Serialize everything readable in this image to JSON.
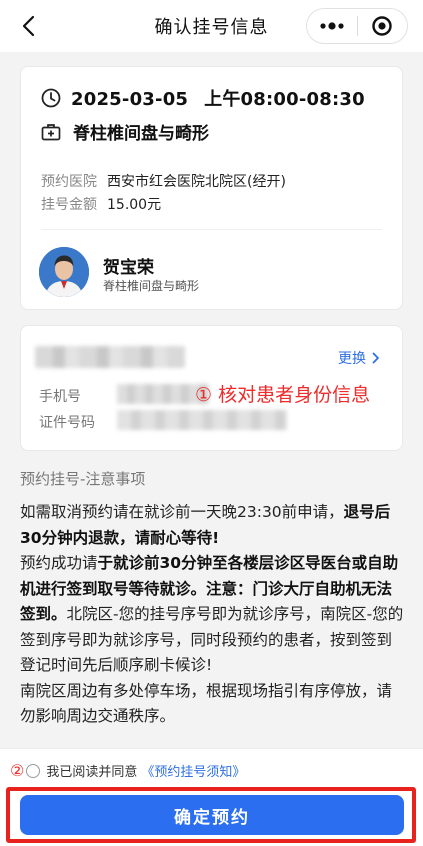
{
  "header": {
    "title": "确认挂号信息"
  },
  "appointment": {
    "date": "2025-03-05",
    "time_slot": "上午08:00-08:30",
    "department": "脊柱椎间盘与畸形",
    "hospital_label": "预约医院",
    "hospital_value": "西安市红会医院北院区(经开)",
    "fee_label": "挂号金额",
    "fee_value": "15.00元"
  },
  "doctor": {
    "name": "贺宝荣",
    "department": "脊柱椎间盘与畸形"
  },
  "patient": {
    "change_label": "更换",
    "phone_label": "手机号",
    "id_label": "证件号码"
  },
  "annotations": {
    "one": "① 核对患者身份信息",
    "two": "②"
  },
  "notice": {
    "title": "预约挂号-注意事项",
    "p1_a": "如需取消预约请在就诊前一天晚23:30前申请，",
    "p1_b": "退号后30分钟内退款，请耐心等待!",
    "p2_a": "预约成功请",
    "p2_b": "于就诊前30分钟至各楼层诊区导医台或自助机进行签到取号等待就诊。注意：门诊大厅自助机无法签到。",
    "p2_c": "北院区-您的挂号序号即为就诊序号，南院区-您的签到序号即为就诊序号，同时段预约的患者，按到签到登记时间先后顺序刷卡候诊!",
    "p3": "南院区周边有多处停车场，根据现场指引有序停放，请勿影响周边交通秩序。"
  },
  "agreement": {
    "text": "我已阅读并同意",
    "link": "《预约挂号须知》"
  },
  "confirm_button": "确定预约",
  "colors": {
    "accent": "#2b6ff0",
    "link": "#2e6fe6",
    "annotation": "#ee2c2c"
  }
}
